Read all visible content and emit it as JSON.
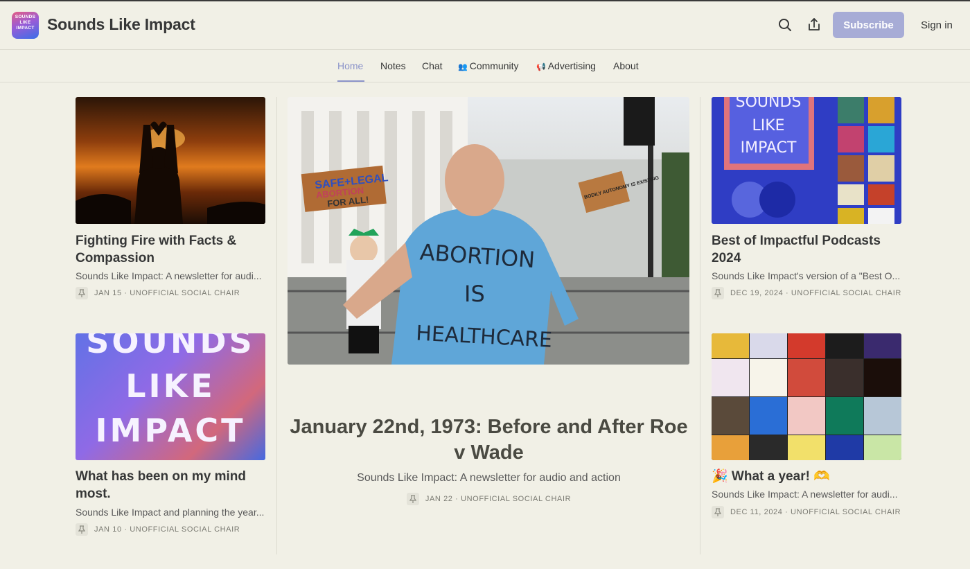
{
  "site": {
    "title": "Sounds Like Impact",
    "logo_text": "SOUNDS LIKE IMPACT",
    "search_icon": "search-icon",
    "share_icon": "share-icon",
    "subscribe_label": "Subscribe",
    "signin_label": "Sign in",
    "accent_color": "#8b93c9",
    "subscribe_color": "#a7acd6"
  },
  "nav": {
    "home": "Home",
    "notes": "Notes",
    "chat": "Chat",
    "community_emoji": "👥",
    "community": "Community",
    "advertising_emoji": "📢",
    "advertising": "Advertising",
    "about": "About"
  },
  "posts": {
    "left_1": {
      "title": "Fighting Fire with Facts & Compassion",
      "subtitle": "Sounds Like Impact: A newsletter for audi...",
      "meta": "JAN 15 · UNOFFICIAL SOCIAL CHAIR"
    },
    "left_2": {
      "title": "What has been on my mind most.",
      "subtitle": "Sounds Like Impact and planning the year...",
      "meta": "JAN 10 · UNOFFICIAL SOCIAL CHAIR",
      "image_text_1": "SOUNDS",
      "image_text_2": "LIKE",
      "image_text_3": "IMPACT"
    },
    "featured": {
      "title": "January 22nd, 1973: Before and After Roe v Wade",
      "subtitle": "Sounds Like Impact: A newsletter for audio and action",
      "meta": "JAN 22 · UNOFFICIAL SOCIAL CHAIR",
      "shirt_text_1": "ABORTION",
      "shirt_text_2": "IS",
      "shirt_text_3": "HEALTHCARE",
      "sign_text_1": "SAFE+LEGAL",
      "sign_text_2": "ABORTION",
      "sign_text_3": "FOR ALL!",
      "sign_text_4": "BODILY AUTONOMY IS EXISTING"
    },
    "right_1": {
      "title": "Best of Impactful Podcasts 2024",
      "subtitle": "Sounds Like Impact's version of a \"Best O...",
      "meta": "DEC 19, 2024 · UNOFFICIAL SOCIAL CHAIR",
      "image_text_1": "SOUNDS",
      "image_text_2": "LIKE",
      "image_text_3": "IMPACT"
    },
    "right_2": {
      "title": "🎉 What a year! 🫶",
      "subtitle": "Sounds Like Impact: A newsletter for audi...",
      "meta": "DEC 11, 2024 · UNOFFICIAL SOCIAL CHAIR"
    }
  }
}
